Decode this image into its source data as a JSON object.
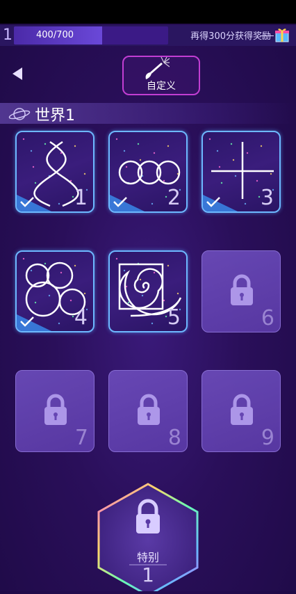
{
  "header": {
    "level": "1",
    "progress_text": "400/700",
    "progress_fraction": 0.571,
    "reward_text": "再得300分获得奖励"
  },
  "toolbar": {
    "back_icon": "back-arrow-icon",
    "custom_label": "自定义",
    "custom_icon": "brush-icon"
  },
  "world": {
    "icon": "planet-icon",
    "title": "世界1"
  },
  "levels": [
    {
      "number": "1",
      "unlocked": true,
      "completed": true,
      "art": "dna-helix"
    },
    {
      "number": "2",
      "unlocked": true,
      "completed": true,
      "art": "three-circles"
    },
    {
      "number": "3",
      "unlocked": true,
      "completed": true,
      "art": "cross"
    },
    {
      "number": "4",
      "unlocked": true,
      "completed": true,
      "art": "bubble-cluster"
    },
    {
      "number": "5",
      "unlocked": true,
      "completed": false,
      "art": "spiral-square"
    },
    {
      "number": "6",
      "unlocked": false,
      "completed": false,
      "art": "lock"
    },
    {
      "number": "7",
      "unlocked": false,
      "completed": false,
      "art": "lock"
    },
    {
      "number": "8",
      "unlocked": false,
      "completed": false,
      "art": "lock"
    },
    {
      "number": "9",
      "unlocked": false,
      "completed": false,
      "art": "lock"
    }
  ],
  "special": {
    "label": "特别",
    "number": "1",
    "icon": "lock-icon"
  },
  "colors": {
    "accent_blue": "#6db8ff",
    "accent_magenta": "#c23ed3",
    "background": "#2a0f5a"
  }
}
